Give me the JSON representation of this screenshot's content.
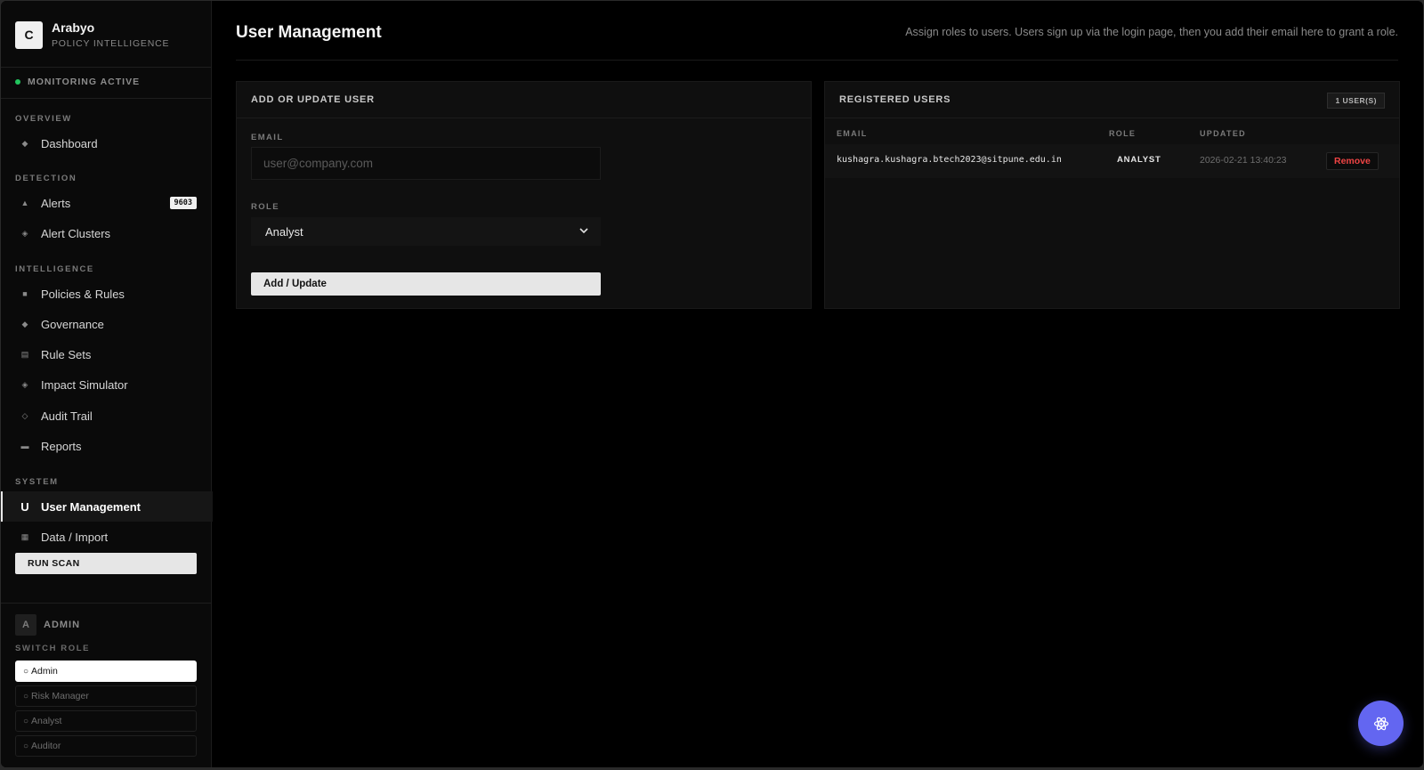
{
  "brand": {
    "logo_letter": "C",
    "name": "Arabyo",
    "subtitle": "POLICY INTELLIGENCE"
  },
  "status": {
    "label": "MONITORING ACTIVE",
    "color": "#22c55e"
  },
  "sidebar": {
    "sections": {
      "overview": "OVERVIEW",
      "detection": "DETECTION",
      "intelligence": "INTELLIGENCE",
      "system": "SYSTEM"
    },
    "items": {
      "dashboard": {
        "label": "Dashboard",
        "icon": "diamond-icon"
      },
      "alerts": {
        "label": "Alerts",
        "icon": "triangle-icon",
        "badge": "9603"
      },
      "alert_clusters": {
        "label": "Alert Clusters",
        "icon": "cluster-diamond-icon"
      },
      "policies": {
        "label": "Policies & Rules",
        "icon": "square-icon"
      },
      "governance": {
        "label": "Governance",
        "icon": "diamond-icon"
      },
      "rule_sets": {
        "label": "Rule Sets",
        "icon": "list-icon"
      },
      "impact_simulator": {
        "label": "Impact Simulator",
        "icon": "diamond-icon"
      },
      "audit_trail": {
        "label": "Audit Trail",
        "icon": "diamond-outline-icon"
      },
      "reports": {
        "label": "Reports",
        "icon": "rect-icon"
      },
      "user_management": {
        "label": "User Management",
        "icon_letter": "U"
      },
      "data_import": {
        "label": "Data / Import",
        "icon": "grid-icon"
      }
    },
    "run_scan": "RUN SCAN",
    "user": {
      "avatar": "A",
      "role": "ADMIN"
    },
    "switch_role": {
      "label": "SWITCH ROLE",
      "options": [
        "Admin",
        "Risk Manager",
        "Analyst",
        "Auditor"
      ],
      "selected": "Admin"
    }
  },
  "header": {
    "title": "User Management",
    "subtitle": "Assign roles to users. Users sign up via the login page, then you add their email here to grant a role."
  },
  "form": {
    "title": "ADD OR UPDATE USER",
    "email_label": "EMAIL",
    "email_placeholder": "user@company.com",
    "email_value": "",
    "role_label": "ROLE",
    "role_value": "Analyst",
    "submit_label": "Add / Update"
  },
  "users": {
    "title": "REGISTERED USERS",
    "count": "1 USER(S)",
    "columns": [
      "EMAIL",
      "ROLE",
      "UPDATED"
    ],
    "rows": [
      {
        "email": "kushagra.kushagra.btech2023@sitpune.edu.in",
        "role": "ANALYST",
        "updated": "2026-02-21 13:40:23",
        "action": "Remove"
      }
    ]
  },
  "fab": {
    "icon": "atom-icon",
    "color": "#6366f1"
  }
}
